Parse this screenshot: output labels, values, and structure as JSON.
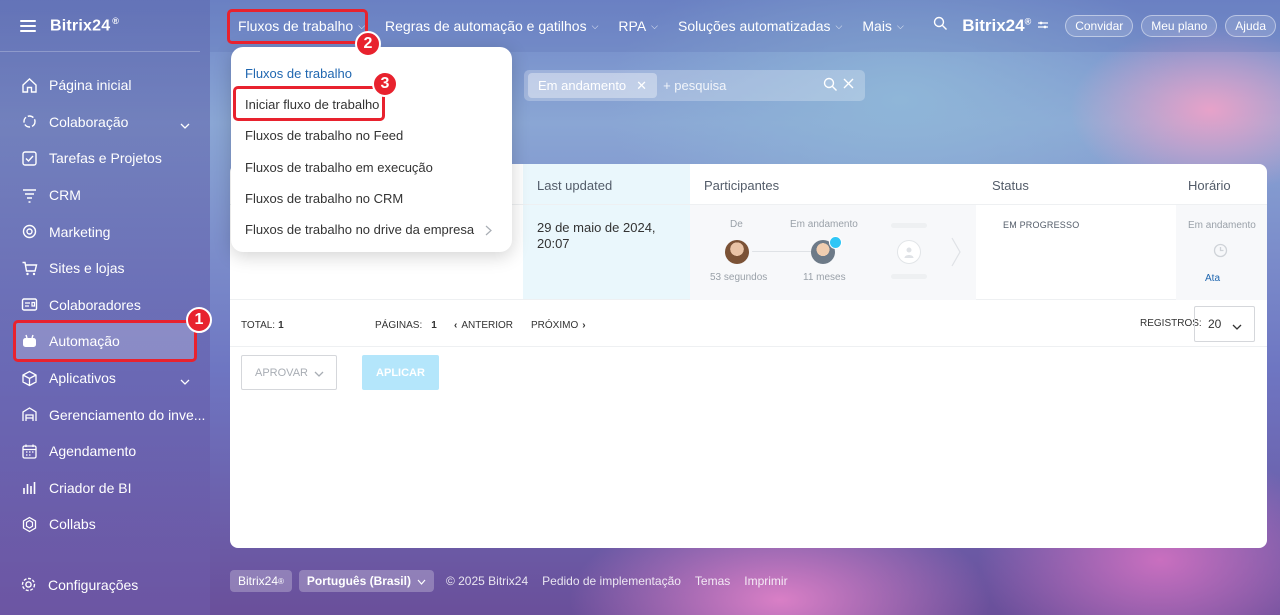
{
  "sidebar": {
    "brand": "Bitrix24",
    "brand_mark": "®",
    "items": [
      {
        "label": "Página inicial",
        "icon": "home-icon"
      },
      {
        "label": "Colaboração",
        "icon": "chat-icon"
      },
      {
        "label": "Tarefas e Projetos",
        "icon": "checkbox-icon"
      },
      {
        "label": "CRM",
        "icon": "crm-funnel-icon"
      },
      {
        "label": "Marketing",
        "icon": "target-icon"
      },
      {
        "label": "Sites e lojas",
        "icon": "cart-icon"
      },
      {
        "label": "Colaboradores",
        "icon": "id-card-icon"
      },
      {
        "label": "Automação",
        "icon": "robot-icon"
      },
      {
        "label": "Aplicativos",
        "icon": "cube-icon"
      },
      {
        "label": "Gerenciamento do inve...",
        "icon": "warehouse-icon"
      },
      {
        "label": "Agendamento",
        "icon": "calendar-icon"
      },
      {
        "label": "Criador de BI",
        "icon": "bar-chart-icon"
      },
      {
        "label": "Collabs",
        "icon": "hexagon-icon"
      }
    ],
    "settings": "Configurações"
  },
  "topbar": {
    "menu": [
      "Fluxos de trabalho",
      "Regras de automação e gatilhos",
      "RPA",
      "Soluções automatizadas",
      "Mais"
    ],
    "brand": "Bitrix24",
    "buttons": [
      "Convidar",
      "Meu plano",
      "Ajuda"
    ]
  },
  "dropdown": {
    "items": [
      "Fluxos de trabalho",
      "Iniciar fluxo de trabalho",
      "Fluxos de trabalho no Feed",
      "Fluxos de trabalho em execução",
      "Fluxos de trabalho no CRM",
      "Fluxos de trabalho no drive da empresa"
    ]
  },
  "search": {
    "chip": "Em andamento",
    "placeholder": "+ pesquisa"
  },
  "table": {
    "headers": {
      "updated": "Last updated",
      "participants": "Participantes",
      "status": "Status",
      "time": "Horário"
    },
    "row": {
      "date": "29 de maio de 2024, 20:07",
      "from_label": "De",
      "from_time": "53 segundos",
      "current_label": "Em andamento",
      "current_time": "11 meses",
      "status": "EM PROGRESSO",
      "time_label": "Em andamento",
      "time_link": "Ata"
    }
  },
  "pager": {
    "total": "TOTAL:",
    "total_value": "1",
    "pages": "PÁGINAS:",
    "pages_value": "1",
    "prev": "ANTERIOR",
    "next": "PRÓXIMO",
    "records": "REGISTROS:",
    "records_value": "20"
  },
  "actions": {
    "approve": "APROVAR",
    "apply": "APLICAR"
  },
  "footer": {
    "brand": "Bitrix24",
    "language": "Português (Brasil)",
    "copyright": "© 2025 Bitrix24",
    "links": [
      "Pedido de implementação",
      "Temas",
      "Imprimir"
    ]
  },
  "annotations": [
    "1",
    "2",
    "3"
  ],
  "colors": {
    "highlight": "#e8222e",
    "accent": "#2067b0",
    "apply_button": "#b4e6fb"
  }
}
